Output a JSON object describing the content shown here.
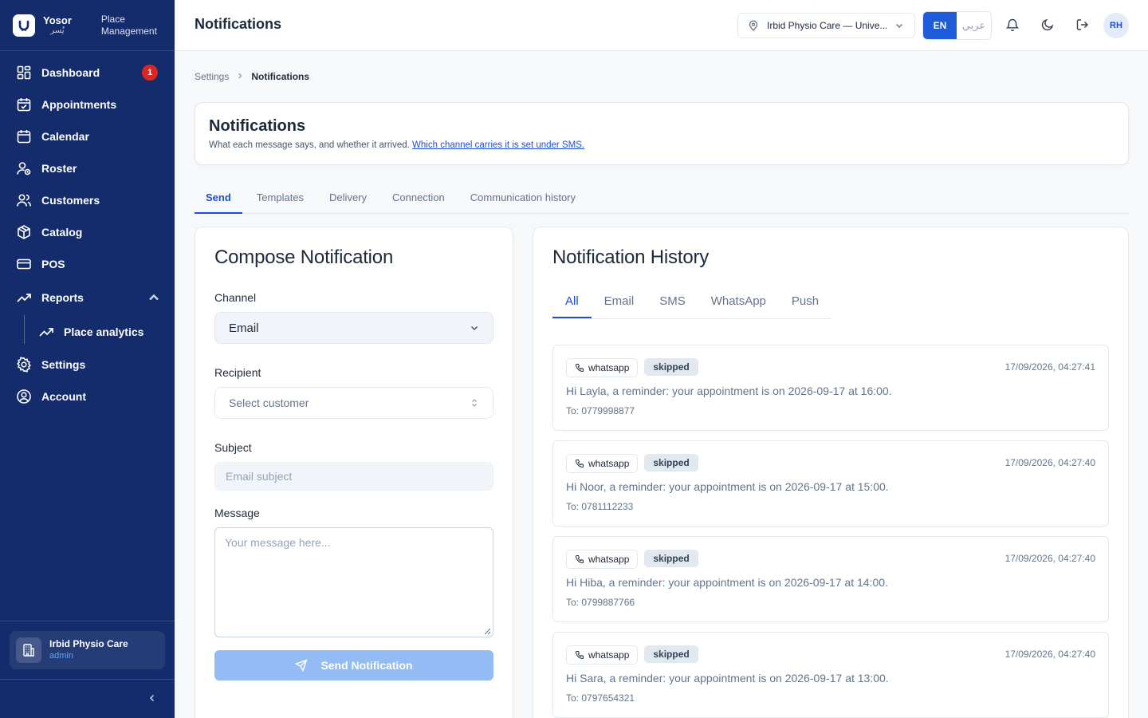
{
  "brand": {
    "name": "Yosor",
    "name_ar": "يُسر",
    "subtitle_line1": "Place",
    "subtitle_line2": "Management"
  },
  "nav": {
    "dashboard": "Dashboard",
    "dashboard_badge": "1",
    "appointments": "Appointments",
    "calendar": "Calendar",
    "roster": "Roster",
    "customers": "Customers",
    "catalog": "Catalog",
    "pos": "POS",
    "reports": "Reports",
    "place_analytics": "Place analytics",
    "settings": "Settings",
    "account": "Account"
  },
  "place": {
    "name": "Irbid Physio Care",
    "role": "admin"
  },
  "header": {
    "title": "Notifications",
    "location": "Irbid Physio Care — Unive...",
    "lang_en": "EN",
    "lang_ar": "عربي",
    "avatar": "RH"
  },
  "breadcrumb": {
    "parent": "Settings",
    "current": "Notifications"
  },
  "intro": {
    "title": "Notifications",
    "text": "What each message says, and whether it arrived.",
    "link": "Which channel carries it is set under SMS."
  },
  "tabs": [
    "Send",
    "Templates",
    "Delivery",
    "Connection",
    "Communication history"
  ],
  "compose": {
    "title": "Compose Notification",
    "channel_label": "Channel",
    "channel_value": "Email",
    "recipient_label": "Recipient",
    "recipient_placeholder": "Select customer",
    "subject_label": "Subject",
    "subject_placeholder": "Email subject",
    "message_label": "Message",
    "message_placeholder": "Your message here...",
    "send_label": "Send Notification"
  },
  "history": {
    "title": "Notification History",
    "tabs": [
      "All",
      "Email",
      "SMS",
      "WhatsApp",
      "Push"
    ],
    "items": [
      {
        "channel": "whatsapp",
        "status": "skipped",
        "time": "17/09/2026, 04:27:41",
        "body": "Hi Layla, a reminder: your appointment is on 2026-09-17 at 16:00.",
        "to": "To: 0779998877"
      },
      {
        "channel": "whatsapp",
        "status": "skipped",
        "time": "17/09/2026, 04:27:40",
        "body": "Hi Noor, a reminder: your appointment is on 2026-09-17 at 15:00.",
        "to": "To: 0781112233"
      },
      {
        "channel": "whatsapp",
        "status": "skipped",
        "time": "17/09/2026, 04:27:40",
        "body": "Hi Hiba, a reminder: your appointment is on 2026-09-17 at 14:00.",
        "to": "To: 0799887766"
      },
      {
        "channel": "whatsapp",
        "status": "skipped",
        "time": "17/09/2026, 04:27:40",
        "body": "Hi Sara, a reminder: your appointment is on 2026-09-17 at 13:00.",
        "to": "To: 0797654321"
      }
    ]
  },
  "colors": {
    "sidebar": "#142c6b",
    "accent": "#1d5bd8",
    "badge": "#dc2626"
  }
}
